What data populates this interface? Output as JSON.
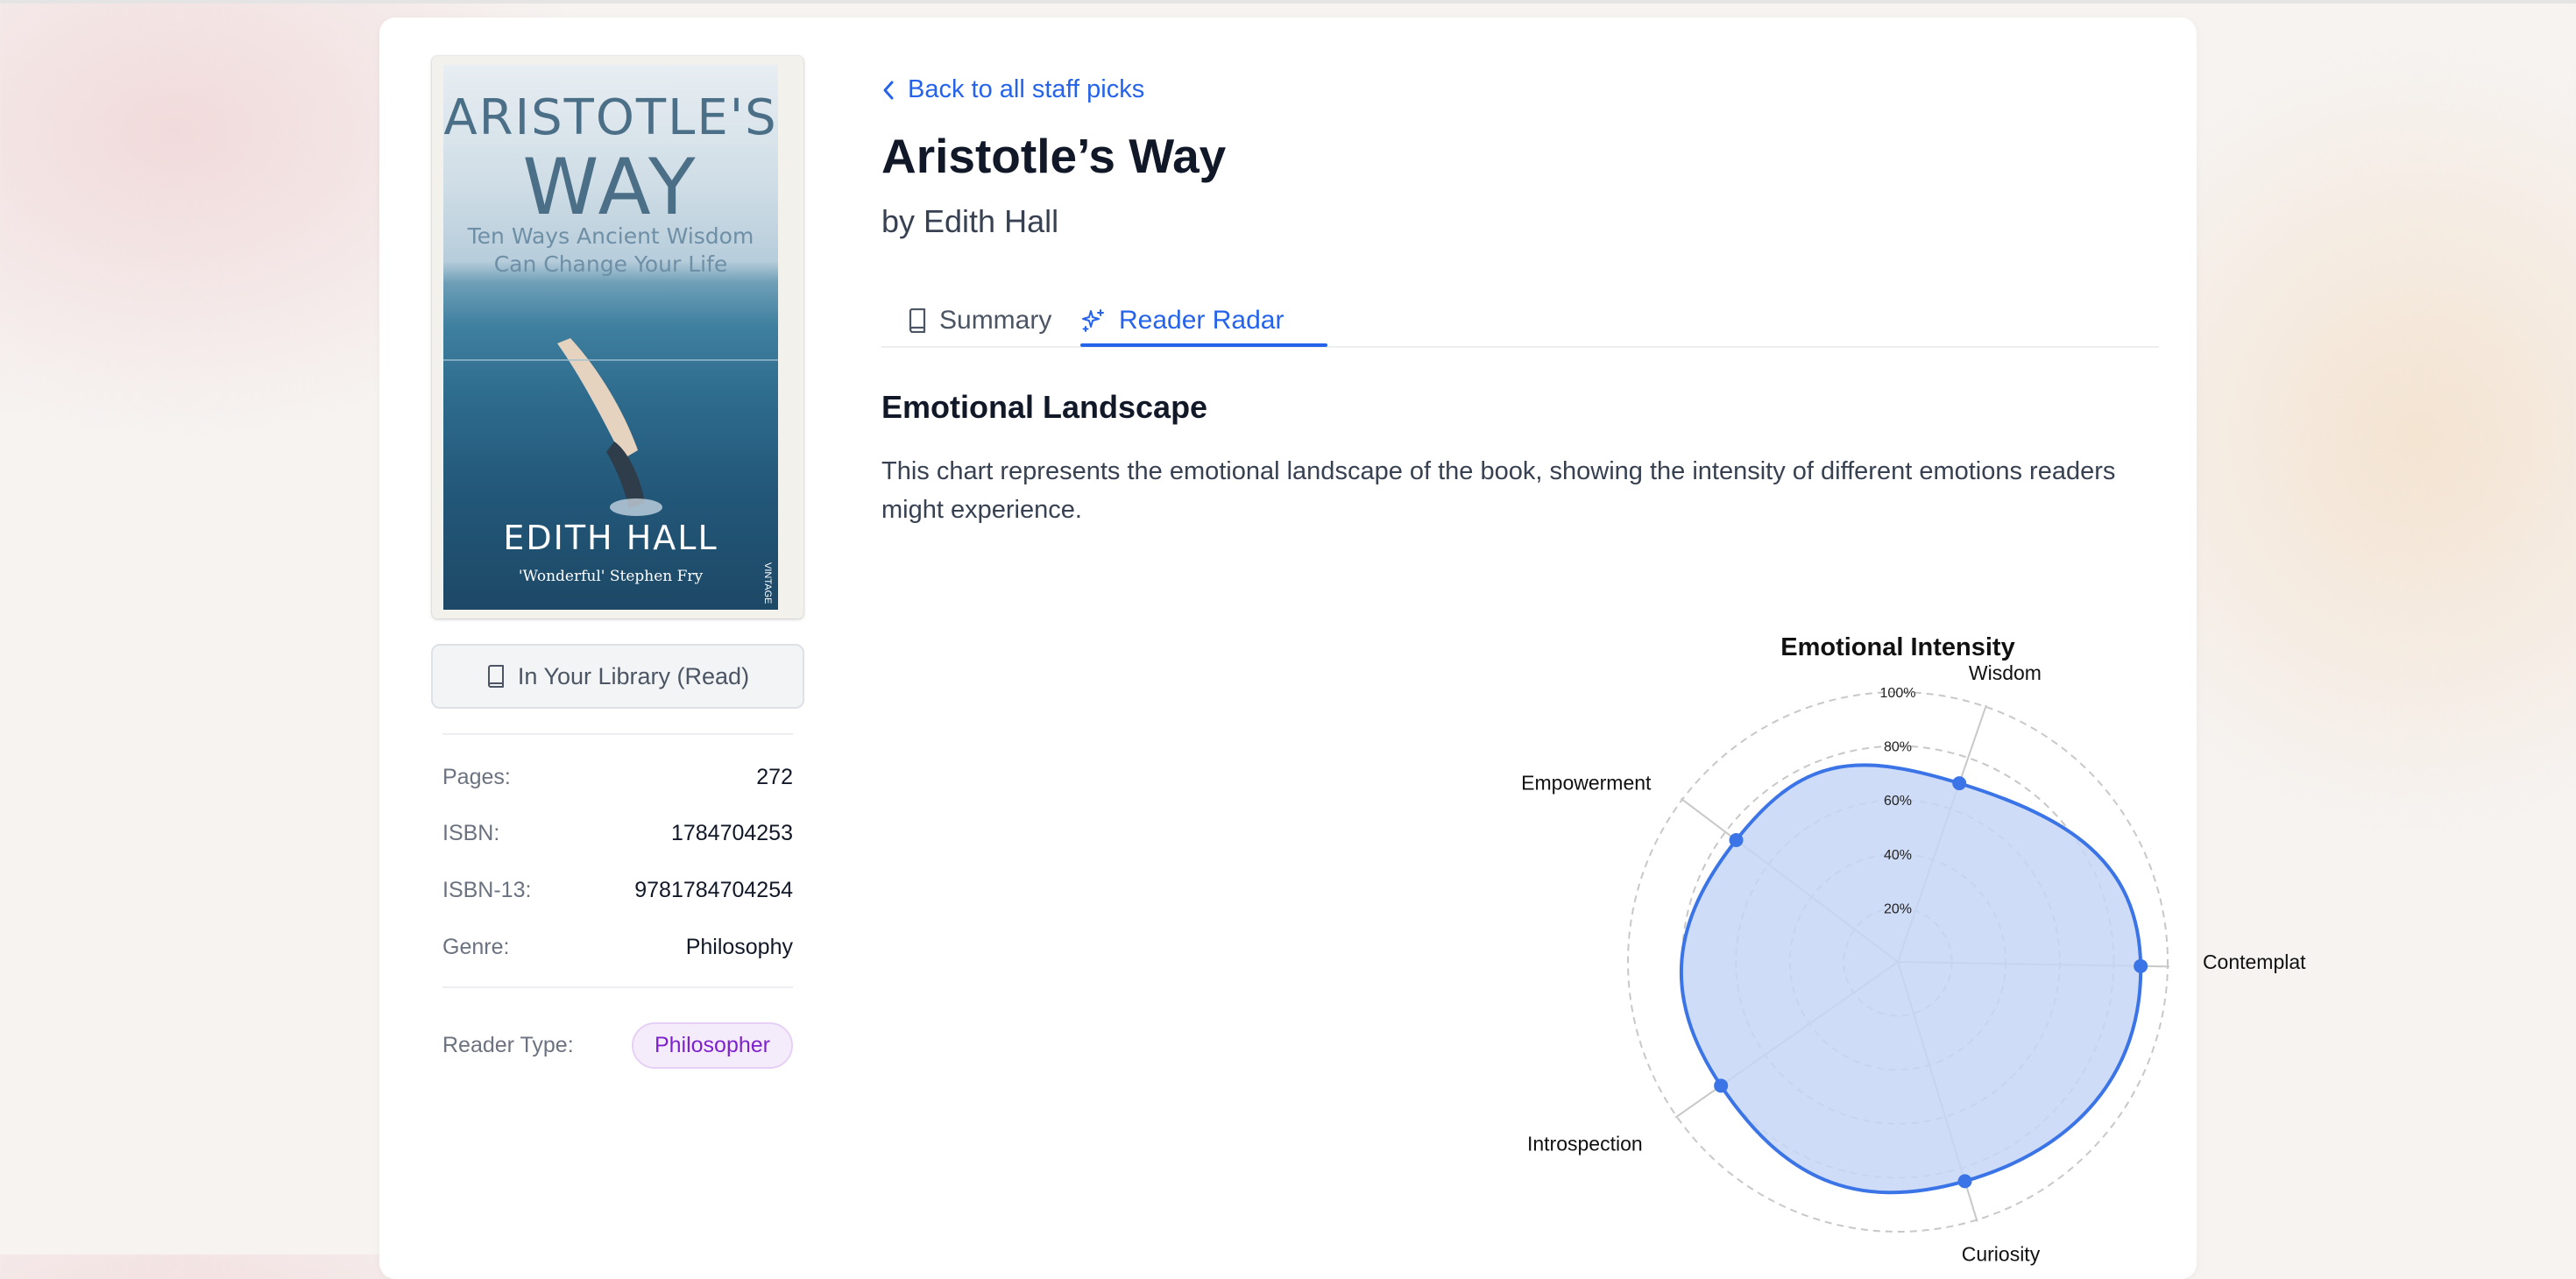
{
  "book": {
    "cover": {
      "title_line1": "ARISTOTLE'S",
      "title_line2": "WAY",
      "subtitle": "Ten Ways Ancient Wisdom Can Change Your Life",
      "author": "EDITH HALL",
      "quote": "'Wonderful' Stephen Fry",
      "publisher": "VINTAGE"
    },
    "library_status": "In Your Library (Read)",
    "meta": [
      {
        "label": "Pages:",
        "value": "272"
      },
      {
        "label": "ISBN:",
        "value": "1784704253"
      },
      {
        "label": "ISBN-13:",
        "value": "9781784704254"
      },
      {
        "label": "Genre:",
        "value": "Philosophy"
      }
    ],
    "reader_type_label": "Reader Type:",
    "reader_type": "Philosopher",
    "title": "Aristotle’s Way",
    "byline": "by Edith Hall"
  },
  "nav": {
    "back_label": "Back to all staff picks"
  },
  "tabs": [
    {
      "label": "Summary",
      "icon": "book-icon",
      "active": false
    },
    {
      "label": "Reader Radar",
      "icon": "sparkles-icon",
      "active": true
    }
  ],
  "section": {
    "title": "Emotional Landscape",
    "description": "This chart represents the emotional landscape of the book, showing the intensity of different emotions readers might experience."
  },
  "colors": {
    "accent": "#2563eb",
    "radar_fill": "#c6d6f7",
    "radar_line": "#3b74e6",
    "badge_text": "#7e22ce"
  },
  "chart_data": {
    "type": "radar",
    "title": "Emotional Intensity",
    "categories": [
      "Wisdom",
      "Contemplat",
      "Curiosity",
      "Introspection",
      "Empowerment"
    ],
    "values": [
      70,
      90,
      85,
      80,
      75
    ],
    "rmax": 100,
    "rtick_labels": [
      "20%",
      "40%",
      "60%",
      "80%",
      "100%"
    ],
    "rticks": [
      20,
      40,
      60,
      80,
      100
    ]
  }
}
